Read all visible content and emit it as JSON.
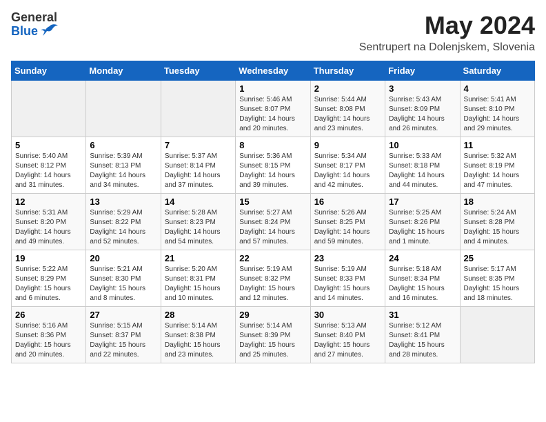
{
  "logo": {
    "general": "General",
    "blue": "Blue"
  },
  "title": "May 2024",
  "subtitle": "Sentrupert na Dolenjskem, Slovenia",
  "days_header": [
    "Sunday",
    "Monday",
    "Tuesday",
    "Wednesday",
    "Thursday",
    "Friday",
    "Saturday"
  ],
  "weeks": [
    {
      "cells": [
        {
          "day": "",
          "info": ""
        },
        {
          "day": "",
          "info": ""
        },
        {
          "day": "",
          "info": ""
        },
        {
          "day": "1",
          "info": "Sunrise: 5:46 AM\nSunset: 8:07 PM\nDaylight: 14 hours\nand 20 minutes."
        },
        {
          "day": "2",
          "info": "Sunrise: 5:44 AM\nSunset: 8:08 PM\nDaylight: 14 hours\nand 23 minutes."
        },
        {
          "day": "3",
          "info": "Sunrise: 5:43 AM\nSunset: 8:09 PM\nDaylight: 14 hours\nand 26 minutes."
        },
        {
          "day": "4",
          "info": "Sunrise: 5:41 AM\nSunset: 8:10 PM\nDaylight: 14 hours\nand 29 minutes."
        }
      ]
    },
    {
      "cells": [
        {
          "day": "5",
          "info": "Sunrise: 5:40 AM\nSunset: 8:12 PM\nDaylight: 14 hours\nand 31 minutes."
        },
        {
          "day": "6",
          "info": "Sunrise: 5:39 AM\nSunset: 8:13 PM\nDaylight: 14 hours\nand 34 minutes."
        },
        {
          "day": "7",
          "info": "Sunrise: 5:37 AM\nSunset: 8:14 PM\nDaylight: 14 hours\nand 37 minutes."
        },
        {
          "day": "8",
          "info": "Sunrise: 5:36 AM\nSunset: 8:15 PM\nDaylight: 14 hours\nand 39 minutes."
        },
        {
          "day": "9",
          "info": "Sunrise: 5:34 AM\nSunset: 8:17 PM\nDaylight: 14 hours\nand 42 minutes."
        },
        {
          "day": "10",
          "info": "Sunrise: 5:33 AM\nSunset: 8:18 PM\nDaylight: 14 hours\nand 44 minutes."
        },
        {
          "day": "11",
          "info": "Sunrise: 5:32 AM\nSunset: 8:19 PM\nDaylight: 14 hours\nand 47 minutes."
        }
      ]
    },
    {
      "cells": [
        {
          "day": "12",
          "info": "Sunrise: 5:31 AM\nSunset: 8:20 PM\nDaylight: 14 hours\nand 49 minutes."
        },
        {
          "day": "13",
          "info": "Sunrise: 5:29 AM\nSunset: 8:22 PM\nDaylight: 14 hours\nand 52 minutes."
        },
        {
          "day": "14",
          "info": "Sunrise: 5:28 AM\nSunset: 8:23 PM\nDaylight: 14 hours\nand 54 minutes."
        },
        {
          "day": "15",
          "info": "Sunrise: 5:27 AM\nSunset: 8:24 PM\nDaylight: 14 hours\nand 57 minutes."
        },
        {
          "day": "16",
          "info": "Sunrise: 5:26 AM\nSunset: 8:25 PM\nDaylight: 14 hours\nand 59 minutes."
        },
        {
          "day": "17",
          "info": "Sunrise: 5:25 AM\nSunset: 8:26 PM\nDaylight: 15 hours\nand 1 minute."
        },
        {
          "day": "18",
          "info": "Sunrise: 5:24 AM\nSunset: 8:28 PM\nDaylight: 15 hours\nand 4 minutes."
        }
      ]
    },
    {
      "cells": [
        {
          "day": "19",
          "info": "Sunrise: 5:22 AM\nSunset: 8:29 PM\nDaylight: 15 hours\nand 6 minutes."
        },
        {
          "day": "20",
          "info": "Sunrise: 5:21 AM\nSunset: 8:30 PM\nDaylight: 15 hours\nand 8 minutes."
        },
        {
          "day": "21",
          "info": "Sunrise: 5:20 AM\nSunset: 8:31 PM\nDaylight: 15 hours\nand 10 minutes."
        },
        {
          "day": "22",
          "info": "Sunrise: 5:19 AM\nSunset: 8:32 PM\nDaylight: 15 hours\nand 12 minutes."
        },
        {
          "day": "23",
          "info": "Sunrise: 5:19 AM\nSunset: 8:33 PM\nDaylight: 15 hours\nand 14 minutes."
        },
        {
          "day": "24",
          "info": "Sunrise: 5:18 AM\nSunset: 8:34 PM\nDaylight: 15 hours\nand 16 minutes."
        },
        {
          "day": "25",
          "info": "Sunrise: 5:17 AM\nSunset: 8:35 PM\nDaylight: 15 hours\nand 18 minutes."
        }
      ]
    },
    {
      "cells": [
        {
          "day": "26",
          "info": "Sunrise: 5:16 AM\nSunset: 8:36 PM\nDaylight: 15 hours\nand 20 minutes."
        },
        {
          "day": "27",
          "info": "Sunrise: 5:15 AM\nSunset: 8:37 PM\nDaylight: 15 hours\nand 22 minutes."
        },
        {
          "day": "28",
          "info": "Sunrise: 5:14 AM\nSunset: 8:38 PM\nDaylight: 15 hours\nand 23 minutes."
        },
        {
          "day": "29",
          "info": "Sunrise: 5:14 AM\nSunset: 8:39 PM\nDaylight: 15 hours\nand 25 minutes."
        },
        {
          "day": "30",
          "info": "Sunrise: 5:13 AM\nSunset: 8:40 PM\nDaylight: 15 hours\nand 27 minutes."
        },
        {
          "day": "31",
          "info": "Sunrise: 5:12 AM\nSunset: 8:41 PM\nDaylight: 15 hours\nand 28 minutes."
        },
        {
          "day": "",
          "info": ""
        }
      ]
    }
  ]
}
